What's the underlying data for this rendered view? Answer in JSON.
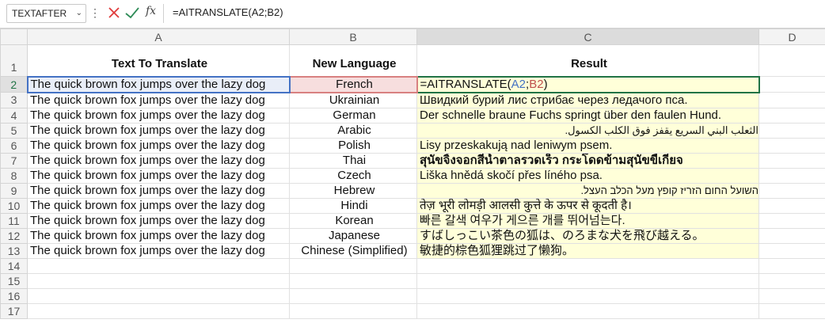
{
  "formula_bar": {
    "name_box": "TEXTAFTER",
    "name_box_chevron": "⌄",
    "menu_dots": "⋮",
    "fx": "fx",
    "formula": "=AITRANSLATE(A2;B2)",
    "cancel_icon": "x-icon",
    "enter_icon": "check-icon",
    "cancel_color": "#e03a3a",
    "enter_color": "#2e8b57"
  },
  "columns": [
    "A",
    "B",
    "C",
    "D"
  ],
  "row_numbers": [
    "1",
    "2",
    "3",
    "4",
    "5",
    "6",
    "7",
    "8",
    "9",
    "10",
    "11",
    "12",
    "13",
    "14",
    "15",
    "16",
    "17"
  ],
  "headers": {
    "text": "Text To Translate",
    "language": "New Language",
    "result": "Result"
  },
  "rows": [
    {
      "text": "The quick brown fox jumps over the lazy dog",
      "language": "French",
      "result": ""
    },
    {
      "text": "The quick brown fox jumps over the lazy dog",
      "language": "Ukrainian",
      "result": "Швидкий бурий лис стрибає через ледачого пса."
    },
    {
      "text": "The quick brown fox jumps over the lazy dog",
      "language": "German",
      "result": "Der schnelle braune Fuchs springt über den faulen Hund."
    },
    {
      "text": "The quick brown fox jumps over the lazy dog",
      "language": "Arabic",
      "result": "الثعلب البني السريع يقفز فوق الكلب الكسول."
    },
    {
      "text": "The quick brown fox jumps over the lazy dog",
      "language": "Polish",
      "result": "Lisy przeskakują nad leniwym psem."
    },
    {
      "text": "The quick brown fox jumps over the lazy dog",
      "language": "Thai",
      "result": "สุนัขจิ้งจอกสีน้ำตาลรวดเร็ว กระโดดข้ามสุนัขขี้เกียจ"
    },
    {
      "text": "The quick brown fox jumps over the lazy dog",
      "language": "Czech",
      "result": "Liška hnědá skočí přes líného psa."
    },
    {
      "text": "The quick brown fox jumps over the lazy dog",
      "language": "Hebrew",
      "result": "השועל החום הזריז קופץ מעל הכלב העצל."
    },
    {
      "text": "The quick brown fox jumps over the lazy dog",
      "language": "Hindi",
      "result": "तेज़ भूरी लोमड़ी आलसी कुत्ते के ऊपर से कूदती है।"
    },
    {
      "text": "The quick brown fox jumps over the lazy dog",
      "language": "Korean",
      "result": "빠른 갈색 여우가 게으른 개를 뛰어넘는다."
    },
    {
      "text": "The quick brown fox jumps over the lazy dog",
      "language": "Japanese",
      "result": "すばしっこい茶色の狐は、のろまな犬を飛び越える。"
    },
    {
      "text": "The quick brown fox jumps over the lazy dog",
      "language": "Chinese (Simplified)",
      "result": "敏捷的棕色狐狸跳过了懒狗。"
    }
  ],
  "editing_cell": {
    "prefix": "=AITRANSLATE(",
    "ref_a": "A2",
    "separator": ";",
    "ref_b": "B2",
    "suffix": ")"
  },
  "colors": {
    "result_fill": "#ffffd9",
    "ref_a": "#4472c4",
    "ref_b": "#c0504d",
    "active_border": "#217346"
  }
}
